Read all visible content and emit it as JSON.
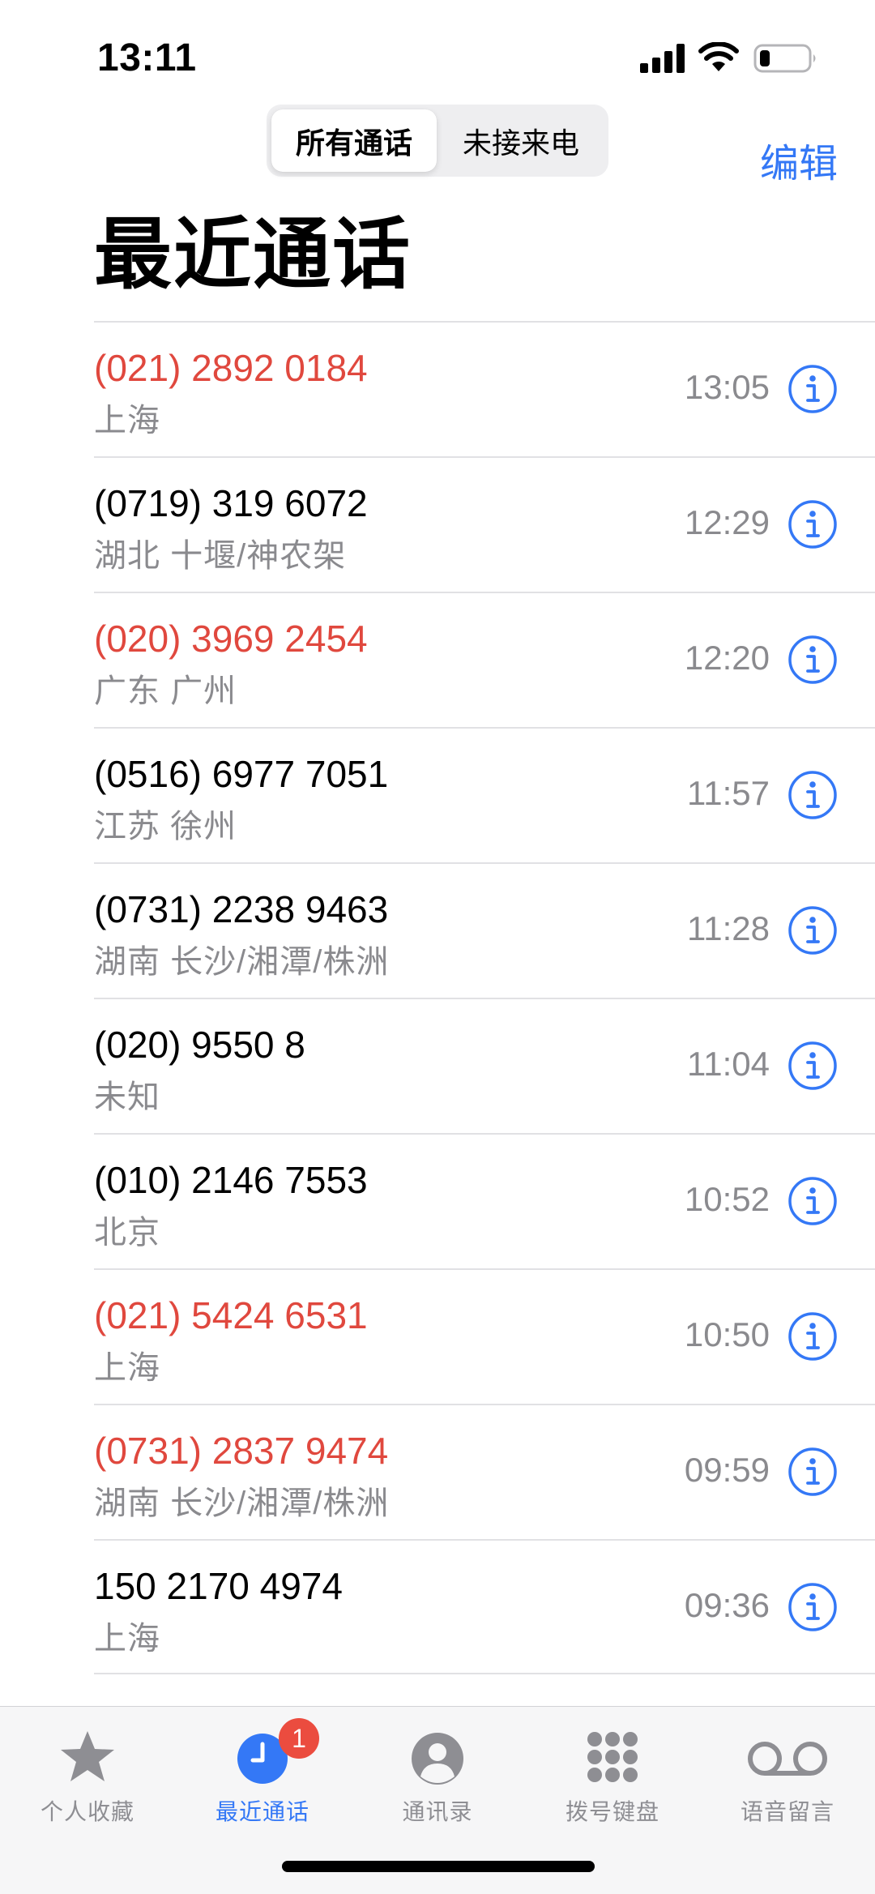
{
  "status_bar": {
    "time": "13:11",
    "icons": [
      "signal-icon",
      "wifi-icon",
      "battery-icon"
    ]
  },
  "nav": {
    "segments": [
      "所有通话",
      "未接来电"
    ],
    "selected_segment": "所有通话",
    "edit_label": "编辑"
  },
  "title": "最近通话",
  "colors": {
    "accent": "#3478f6",
    "missed": "#e0483e",
    "secondary_text": "#8a8a8e",
    "badge": "#eb4c3f"
  },
  "calls": [
    {
      "number": "(021) 2892 0184",
      "location": "上海",
      "time": "13:05",
      "missed": true
    },
    {
      "number": "(0719) 319 6072",
      "location": "湖北 十堰/神农架",
      "time": "12:29",
      "missed": false
    },
    {
      "number": "(020) 3969 2454",
      "location": "广东 广州",
      "time": "12:20",
      "missed": true
    },
    {
      "number": "(0516) 6977 7051",
      "location": "江苏 徐州",
      "time": "11:57",
      "missed": false
    },
    {
      "number": "(0731) 2238 9463",
      "location": "湖南 长沙/湘潭/株洲",
      "time": "11:28",
      "missed": false
    },
    {
      "number": "(020) 9550 8",
      "location": "未知",
      "time": "11:04",
      "missed": false
    },
    {
      "number": "(010) 2146 7553",
      "location": "北京",
      "time": "10:52",
      "missed": false
    },
    {
      "number": "(021) 5424 6531",
      "location": "上海",
      "time": "10:50",
      "missed": true
    },
    {
      "number": "(0731) 2837 9474",
      "location": "湖南 长沙/湘潭/株洲",
      "time": "09:59",
      "missed": true
    },
    {
      "number": "150 2170 4974",
      "location": "上海",
      "time": "09:36",
      "missed": false
    }
  ],
  "tabs": [
    {
      "label": "个人收藏",
      "icon": "star-icon",
      "active": false
    },
    {
      "label": "最近通话",
      "icon": "clock-icon",
      "active": true,
      "badge": "1"
    },
    {
      "label": "通讯录",
      "icon": "person-icon",
      "active": false
    },
    {
      "label": "拨号键盘",
      "icon": "keypad-icon",
      "active": false
    },
    {
      "label": "语音留言",
      "icon": "voicemail-icon",
      "active": false
    }
  ]
}
